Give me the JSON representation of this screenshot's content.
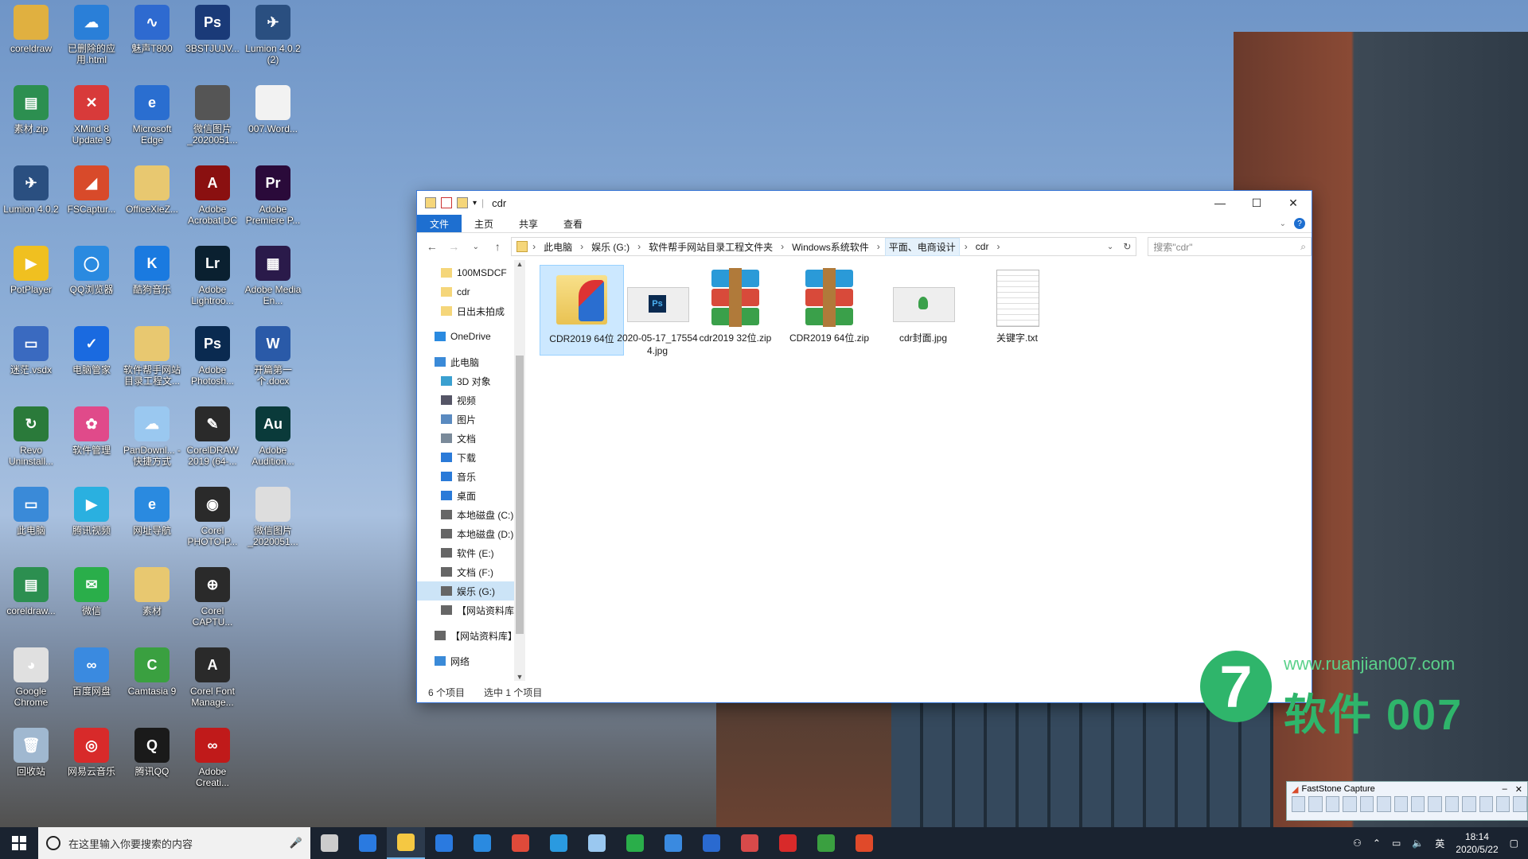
{
  "desktop": {
    "icons": [
      {
        "label": "coreldraw",
        "color": "#e0b040",
        "glyph": ""
      },
      {
        "label": "已删除的应用.html",
        "color": "#2a7fd8",
        "glyph": "☁"
      },
      {
        "label": "魅声T800",
        "color": "#2e6ad0",
        "glyph": "∿"
      },
      {
        "label": "3BSTJUJV...",
        "color": "#1a3a78",
        "glyph": "Ps"
      },
      {
        "label": "Lumion 4.0.2 (2)",
        "color": "#2a4f80",
        "glyph": "✈"
      },
      {
        "label": "素材.zip",
        "color": "#2c8f50",
        "glyph": "▤"
      },
      {
        "label": "XMind 8 Update 9",
        "color": "#d83a3a",
        "glyph": "✕"
      },
      {
        "label": "Microsoft Edge",
        "color": "#2a6ed0",
        "glyph": "e"
      },
      {
        "label": "微信图片_2020051...",
        "color": "#555555",
        "glyph": ""
      },
      {
        "label": "007.Word...",
        "color": "#f2f2f2",
        "glyph": ""
      },
      {
        "label": "Lumion 4.0.2",
        "color": "#2a4f80",
        "glyph": "✈"
      },
      {
        "label": "FSCaptur...",
        "color": "#d84a2a",
        "glyph": "◢"
      },
      {
        "label": "OfficeXieZ...",
        "color": "#e8c870",
        "glyph": ""
      },
      {
        "label": "Adobe Acrobat DC",
        "color": "#8a1010",
        "glyph": "A"
      },
      {
        "label": "Adobe Premiere P...",
        "color": "#2a0a3a",
        "glyph": "Pr"
      },
      {
        "label": "PotPlayer",
        "color": "#f0c020",
        "glyph": "▶"
      },
      {
        "label": "QQ浏览器",
        "color": "#2a8ae0",
        "glyph": "◯"
      },
      {
        "label": "酷狗音乐",
        "color": "#1a7ae0",
        "glyph": "K"
      },
      {
        "label": "Adobe Lightroo...",
        "color": "#0a2030",
        "glyph": "Lr"
      },
      {
        "label": "Adobe Media En...",
        "color": "#2a1a4a",
        "glyph": "▦"
      },
      {
        "label": "迷茫.vsdx",
        "color": "#3a6ac0",
        "glyph": "▭"
      },
      {
        "label": "电脑管家",
        "color": "#1a6ae0",
        "glyph": "✓"
      },
      {
        "label": "软件帮手网站目录工程文...",
        "color": "#e8c870",
        "glyph": ""
      },
      {
        "label": "Adobe Photosh...",
        "color": "#0a2a50",
        "glyph": "Ps"
      },
      {
        "label": "开篇第一个.docx",
        "color": "#2a5aa8",
        "glyph": "W"
      },
      {
        "label": "Revo Uninstall...",
        "color": "#2a7a3a",
        "glyph": "↻"
      },
      {
        "label": "软件管理",
        "color": "#e04a8a",
        "glyph": "✿"
      },
      {
        "label": "PanDownl... - 快捷方式",
        "color": "#9ac8f0",
        "glyph": "☁"
      },
      {
        "label": "CorelDRAW 2019 (64-...",
        "color": "#2a2a2a",
        "glyph": "✎"
      },
      {
        "label": "Adobe Audition...",
        "color": "#0a3a3a",
        "glyph": "Au"
      },
      {
        "label": "此电脑",
        "color": "#3a8ad8",
        "glyph": "▭"
      },
      {
        "label": "腾讯视频",
        "color": "#2ab0e0",
        "glyph": "▶"
      },
      {
        "label": "网址导航",
        "color": "#2a8ae0",
        "glyph": "e"
      },
      {
        "label": "Corel PHOTO-P...",
        "color": "#2a2a2a",
        "glyph": "◉"
      },
      {
        "label": "微信图片_2020051...",
        "color": "#dddddd",
        "glyph": ""
      },
      {
        "label": "coreldraw...",
        "color": "#2c8f50",
        "glyph": "▤"
      },
      {
        "label": "微信",
        "color": "#2aae4a",
        "glyph": "✉"
      },
      {
        "label": "素材",
        "color": "#e8c870",
        "glyph": ""
      },
      {
        "label": "Corel CAPTU...",
        "color": "#2a2a2a",
        "glyph": "⊕"
      },
      {
        "label": "",
        "color": "transparent",
        "glyph": ""
      },
      {
        "label": "Google Chrome",
        "color": "#e0e0e0",
        "glyph": "◕"
      },
      {
        "label": "百度网盘",
        "color": "#3a8ae0",
        "glyph": "∞"
      },
      {
        "label": "Camtasia 9",
        "color": "#3aa040",
        "glyph": "C"
      },
      {
        "label": "Corel Font Manage...",
        "color": "#2a2a2a",
        "glyph": "A"
      },
      {
        "label": "",
        "color": "transparent",
        "glyph": ""
      },
      {
        "label": "回收站",
        "color": "#a0b8d0",
        "glyph": "🗑"
      },
      {
        "label": "网易云音乐",
        "color": "#d82a2a",
        "glyph": "◎"
      },
      {
        "label": "腾讯QQ",
        "color": "#1a1a1a",
        "glyph": "Q"
      },
      {
        "label": "Adobe Creati...",
        "color": "#c01a1a",
        "glyph": "∞"
      }
    ]
  },
  "window": {
    "title": "cdr",
    "ribbon": {
      "tabs": [
        "文件",
        "主页",
        "共享",
        "查看"
      ]
    },
    "nav_buttons": {
      "back": "←",
      "forward": "→",
      "recent": "⌄",
      "up": "↑",
      "refresh": "↻",
      "dropdown": "⌄"
    },
    "breadcrumbs": [
      "此电脑",
      "娱乐 (G:)",
      "软件帮手网站目录工程文件夹",
      "Windows系统软件",
      "平面、电商设计",
      "cdr"
    ],
    "search": {
      "placeholder": "搜索\"cdr\""
    },
    "nav_pane": [
      {
        "label": "100MSDCF",
        "icon": "folder",
        "indent": 1
      },
      {
        "label": "cdr",
        "icon": "folder",
        "indent": 1
      },
      {
        "label": "日出未拍成",
        "icon": "folder",
        "indent": 1
      },
      {
        "label": "OneDrive",
        "icon": "cloud",
        "indent": 0
      },
      {
        "label": "此电脑",
        "icon": "pc",
        "indent": 0
      },
      {
        "label": "3D 对象",
        "icon": "3d",
        "indent": 1
      },
      {
        "label": "视频",
        "icon": "video",
        "indent": 1
      },
      {
        "label": "图片",
        "icon": "pic",
        "indent": 1
      },
      {
        "label": "文档",
        "icon": "doc",
        "indent": 1
      },
      {
        "label": "下载",
        "icon": "download",
        "indent": 1
      },
      {
        "label": "音乐",
        "icon": "music",
        "indent": 1
      },
      {
        "label": "桌面",
        "icon": "desktop",
        "indent": 1
      },
      {
        "label": "本地磁盘 (C:)",
        "icon": "drive",
        "indent": 1
      },
      {
        "label": "本地磁盘 (D:)",
        "icon": "drive",
        "indent": 1
      },
      {
        "label": "软件 (E:)",
        "icon": "drive",
        "indent": 1
      },
      {
        "label": "文档 (F:)",
        "icon": "drive",
        "indent": 1
      },
      {
        "label": "娱乐 (G:)",
        "icon": "drive",
        "indent": 1,
        "selected": true
      },
      {
        "label": "【网站资料库】",
        "icon": "drive",
        "indent": 1
      },
      {
        "label": "【网站资料库】 (I",
        "icon": "drive",
        "indent": 0
      },
      {
        "label": "网络",
        "icon": "network",
        "indent": 0
      }
    ],
    "files": [
      {
        "name": "CDR2019 64位",
        "type": "folder",
        "selected": true
      },
      {
        "name": "2020-05-17_175544.jpg",
        "type": "psd"
      },
      {
        "name": "cdr2019 32位.zip",
        "type": "zip"
      },
      {
        "name": "CDR2019 64位.zip",
        "type": "zip"
      },
      {
        "name": "cdr封面.jpg",
        "type": "jpg"
      },
      {
        "name": "关键字.txt",
        "type": "txt"
      }
    ],
    "status": {
      "count": "6 个项目",
      "selected": "选中 1 个项目"
    }
  },
  "watermark": {
    "url": "www.ruanjian007.com",
    "brand": "软件 007",
    "logo": "7"
  },
  "faststone": {
    "title": "FastStone Capture"
  },
  "taskbar": {
    "search_placeholder": "在这里输入你要搜索的内容",
    "apps": [
      "task-view",
      "edge",
      "explorer",
      "store",
      "mail",
      "chrome",
      "qq-browser",
      "onedrive",
      "wechat",
      "baidu-netdisk",
      "audio",
      "assistant",
      "netease-music",
      "camtasia",
      "camtasia-rec"
    ],
    "tray_lang": "英",
    "time": "18:14",
    "date": "2020/5/22"
  }
}
